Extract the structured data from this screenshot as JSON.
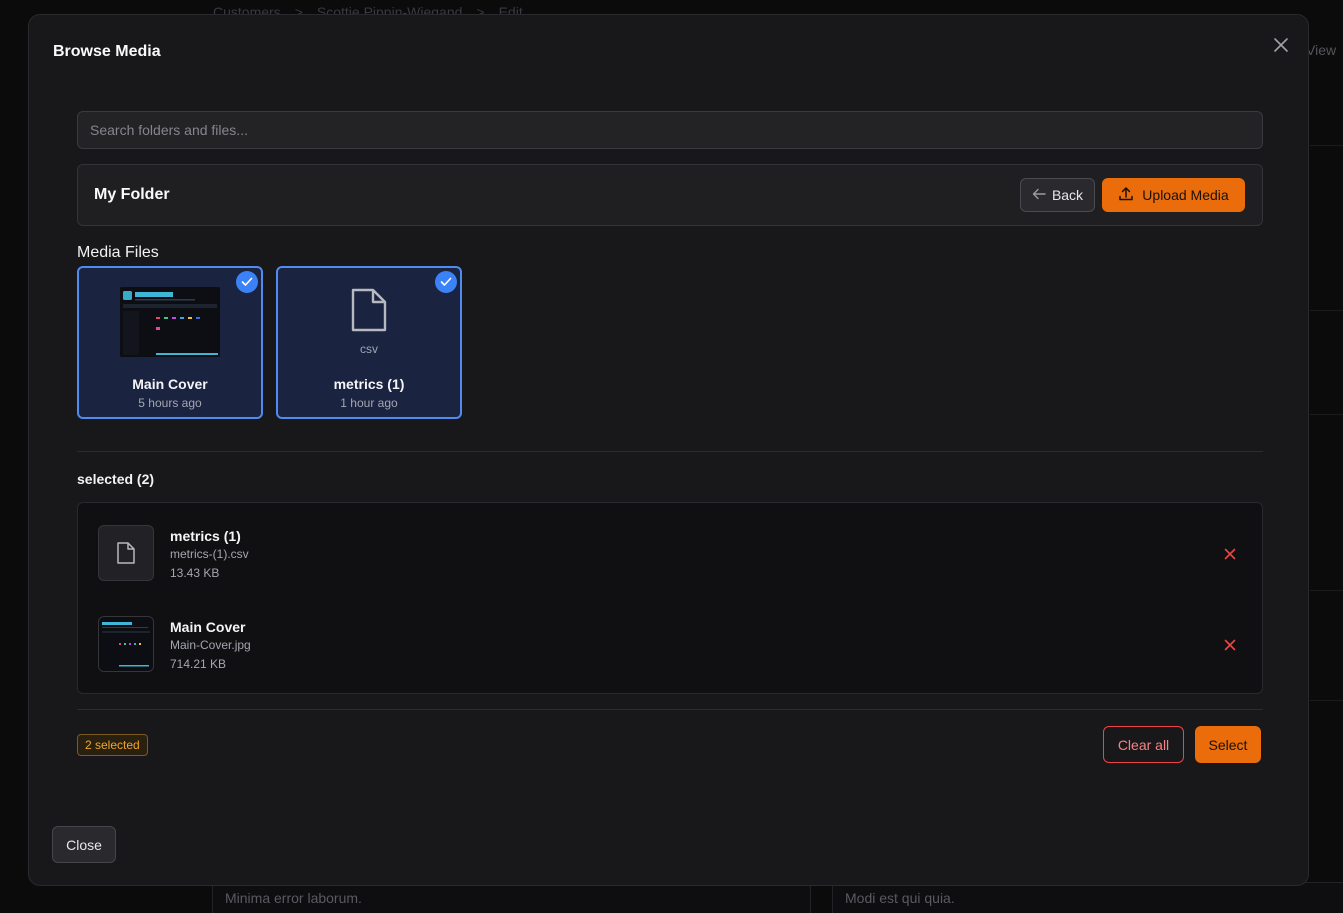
{
  "background": {
    "breadcrumb": [
      "Customers",
      ">",
      "Scottie Pippin-Wiegand",
      ">",
      "Edit"
    ],
    "view_label": "View",
    "card_left_text": "Minima error laborum.",
    "card_right_text": "Modi est qui quia."
  },
  "modal": {
    "title": "Browse Media",
    "search_placeholder": "Search folders and files...",
    "folder_title": "My Folder",
    "back_label": "Back",
    "upload_label": "Upload Media",
    "section_label": "Media Files",
    "files": [
      {
        "name": "Main Cover",
        "meta": "5 hours ago",
        "selected": true,
        "thumb_title": "Media Manager"
      },
      {
        "name": "metrics (1)",
        "meta": "1 hour ago",
        "selected": true,
        "ext": "csv"
      }
    ],
    "selected_heading": "selected (2)",
    "selected_items": [
      {
        "name": "metrics (1)",
        "filename": "metrics-(1).csv",
        "size": "13.43 KB"
      },
      {
        "name": "Main Cover",
        "filename": "Main-Cover.jpg",
        "size": "714.21 KB"
      }
    ],
    "count_badge": "2 selected",
    "clear_label": "Clear all",
    "select_label": "Select",
    "close_label": "Close"
  },
  "colors": {
    "accent": "#ea6c0a",
    "selection": "#3b82f6",
    "danger": "#ef4444",
    "badge": "#f0a72a"
  },
  "icons": [
    "close-icon",
    "arrow-left-icon",
    "upload-icon",
    "check-icon",
    "file-icon",
    "remove-icon"
  ]
}
